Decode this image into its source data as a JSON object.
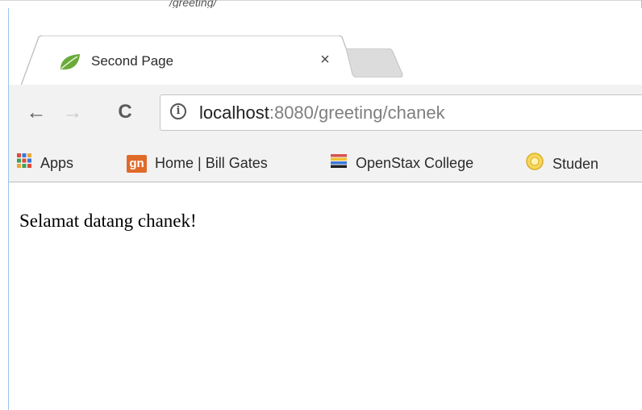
{
  "header_snippet": "/greeting/",
  "tab": {
    "title": "Second Page",
    "close_glyph": "×",
    "favicon": "spring-leaf-icon"
  },
  "toolbar": {
    "back_glyph": "←",
    "forward_glyph": "→",
    "reload_glyph": "C",
    "info_glyph": "i"
  },
  "address": {
    "host": "localhost",
    "path": ":8080/greeting/chanek"
  },
  "bookmarks": [
    {
      "label": "Apps",
      "icon": "apps-grid-icon"
    },
    {
      "label": "Home | Bill Gates",
      "icon": "gn-icon",
      "badge": "gn"
    },
    {
      "label": "OpenStax College",
      "icon": "books-stack-icon"
    },
    {
      "label": "Studen",
      "icon": "university-seal-icon"
    }
  ],
  "page": {
    "greeting": "Selamat datang chanek!"
  },
  "colors": {
    "accent_gn": "#e06a2a",
    "leaf_green": "#6aaa3a",
    "url_path_gray": "#7f7f7f"
  }
}
